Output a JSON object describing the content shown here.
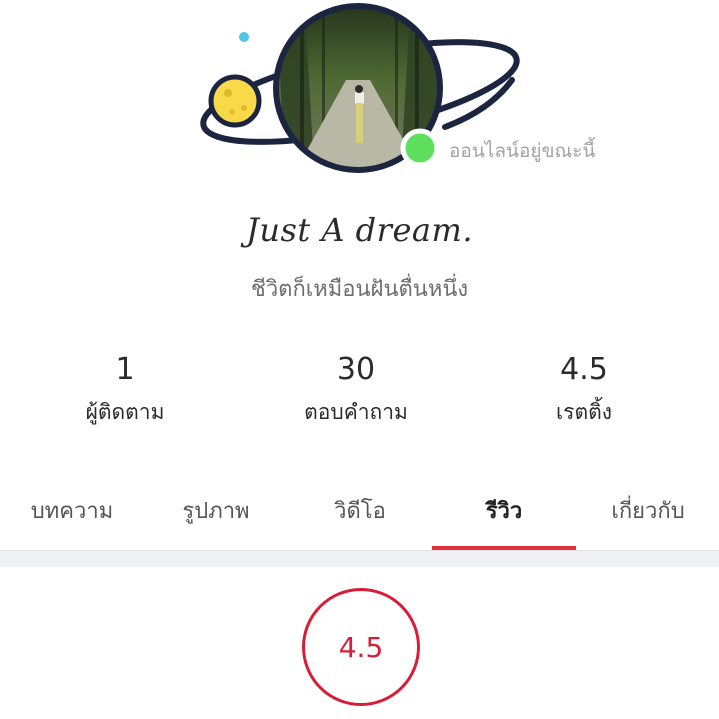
{
  "profile": {
    "online_status": "ออนไลน์อยู่ขณะนี้",
    "name": "Just A dream.",
    "bio": "ชีวิตก็เหมือนฝันตื่นหนึ่ง"
  },
  "stats": [
    {
      "value": "1",
      "label": "ผู้ติดตาม"
    },
    {
      "value": "30",
      "label": "ตอบคำถาม"
    },
    {
      "value": "4.5",
      "label": "เรตติ้ง"
    }
  ],
  "tabs": [
    {
      "label": "บทความ",
      "active": false
    },
    {
      "label": "รูปภาพ",
      "active": false
    },
    {
      "label": "วิดีโอ",
      "active": false
    },
    {
      "label": "รีวิว",
      "active": true
    },
    {
      "label": "เกี่ยวกับ",
      "active": false
    }
  ],
  "review": {
    "rating": "4.5"
  },
  "colors": {
    "accent": "#e0303c",
    "rating": "#d81e36",
    "online_dot": "#5ee05e",
    "planet": "#f7d94a",
    "ring": "#1c2540"
  }
}
